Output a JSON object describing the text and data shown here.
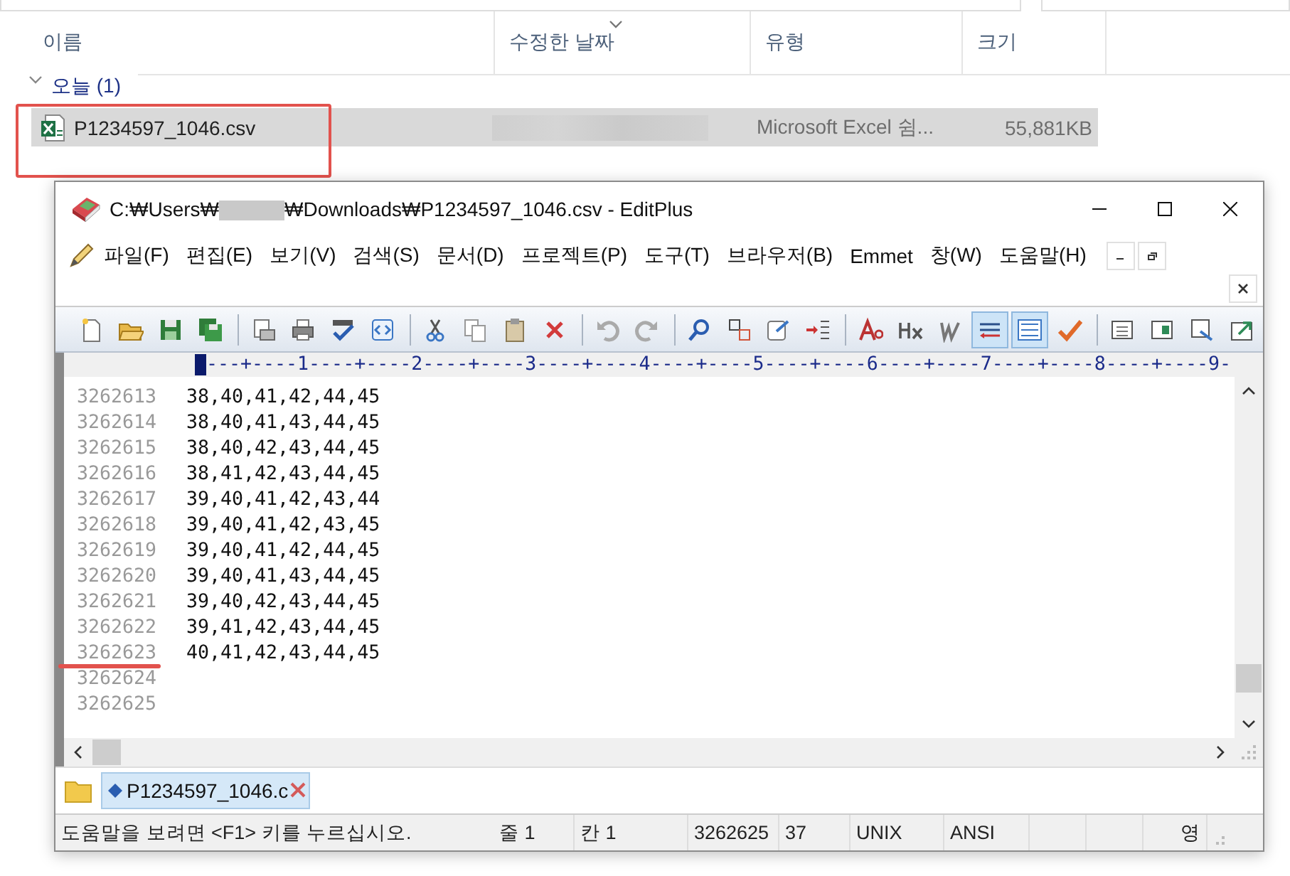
{
  "explorer": {
    "columns": [
      {
        "label": "이름",
        "sorted": false
      },
      {
        "label": "수정한 날짜",
        "sorted": true
      },
      {
        "label": "유형",
        "sorted": false
      },
      {
        "label": "크기",
        "sorted": false
      }
    ],
    "group": {
      "label": "오늘 (1)",
      "expanded": true
    },
    "files": [
      {
        "name": "P1234597_1046.csv",
        "type": "Microsoft Excel 쉼...",
        "size": "55,881KB",
        "selected": true,
        "highlighted": true
      }
    ]
  },
  "editor_window": {
    "title_before_redaction": "C:₩Users₩",
    "title_after_redaction": "₩Downloads₩P1234597_1046.csv - EditPlus",
    "menu": [
      "파일(F)",
      "편집(E)",
      "보기(V)",
      "검색(S)",
      "문서(D)",
      "프로젝트(P)",
      "도구(T)",
      "브라우저(B)",
      "Emmet",
      "창(W)",
      "도움말(H)"
    ],
    "toolbar": [
      {
        "on": false
      },
      {
        "on": false
      },
      {
        "on": false
      },
      {
        "on": false
      },
      {
        "on": false
      },
      {
        "on": false
      },
      {
        "on": false
      },
      {
        "on": false
      },
      {
        "on": false
      },
      {
        "on": false
      },
      {
        "on": false
      },
      {
        "on": false
      },
      {
        "on": false
      },
      {
        "on": false
      },
      {
        "on": false
      },
      {
        "on": false
      },
      {
        "on": false
      },
      {
        "on": false
      },
      {
        "on": false
      },
      {
        "on": false
      },
      {
        "on": false
      },
      {
        "on": true
      },
      {
        "on": true
      },
      {
        "on": false
      },
      {
        "on": false
      },
      {
        "on": false
      },
      {
        "on": false
      },
      {
        "on": false
      }
    ],
    "ruler": "---+----1----+----2----+----3----+----4----+----5----+----6----+----7----+----8----+----9-",
    "lines": [
      {
        "number": "3262613",
        "text": "38,40,41,42,44,45",
        "marked": false
      },
      {
        "number": "3262614",
        "text": "38,40,41,43,44,45",
        "marked": false
      },
      {
        "number": "3262615",
        "text": "38,40,42,43,44,45",
        "marked": false
      },
      {
        "number": "3262616",
        "text": "38,41,42,43,44,45",
        "marked": false
      },
      {
        "number": "3262617",
        "text": "39,40,41,42,43,44",
        "marked": false
      },
      {
        "number": "3262618",
        "text": "39,40,41,42,43,45",
        "marked": false
      },
      {
        "number": "3262619",
        "text": "39,40,41,42,44,45",
        "marked": false
      },
      {
        "number": "3262620",
        "text": "39,40,41,43,44,45",
        "marked": false
      },
      {
        "number": "3262621",
        "text": "39,40,42,43,44,45",
        "marked": false
      },
      {
        "number": "3262622",
        "text": "39,41,42,43,44,45",
        "marked": false
      },
      {
        "number": "3262623",
        "text": "40,41,42,43,44,45",
        "marked": true
      },
      {
        "number": "3262624",
        "marked": false
      },
      {
        "number": "3262625",
        "marked": false
      }
    ],
    "tabs": [
      {
        "label": "P1234597_1046.c",
        "selected": true
      }
    ],
    "status_bar": [
      "도움말을 보려면 <F1> 키를 누르십시오.",
      "줄 1",
      "칸 1",
      "3262625",
      "37",
      "UNIX",
      "ANSI",
      "영"
    ]
  }
}
